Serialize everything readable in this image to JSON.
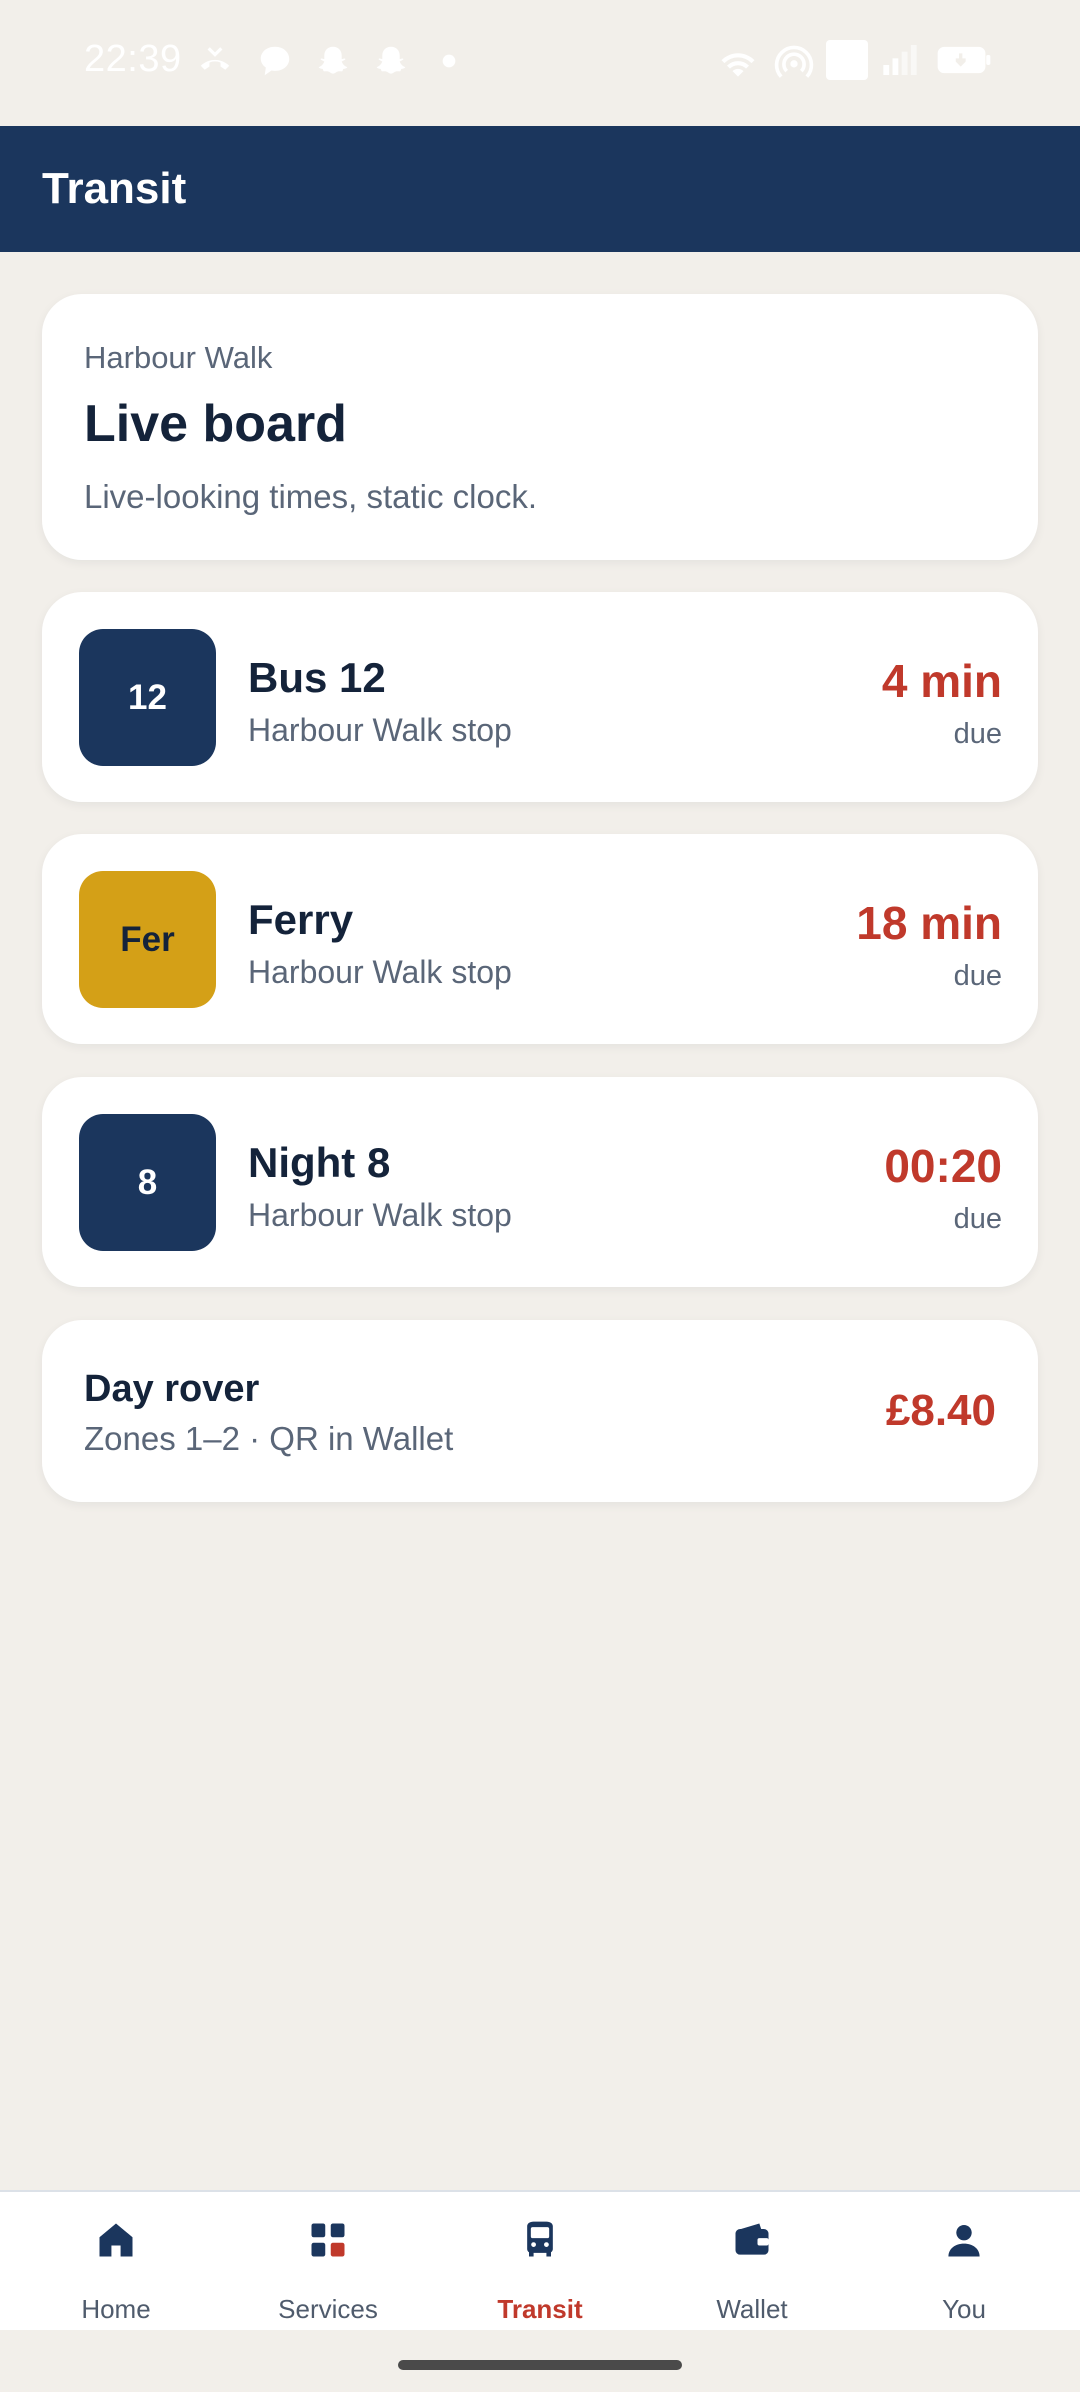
{
  "status_bar": {
    "time": "22:39",
    "left_icons": [
      "missed-call-icon",
      "chat-bubble-icon",
      "snapchat-ghost-icon",
      "snapchat-ghost-icon",
      "dot-icon"
    ],
    "right_icons": [
      "wifi-icon",
      "hotspot-icon",
      "vowifi-icon",
      "cellular-signal-icon",
      "battery-charging-icon"
    ]
  },
  "app_bar": {
    "title": "Transit"
  },
  "hero": {
    "kicker": "Harbour Walk",
    "title": "Live board",
    "subtitle": "Live-looking times, static clock."
  },
  "departures": [
    {
      "badge": "12",
      "badge_color": "#1B365D",
      "badge_text_color": "#FFFFFF",
      "title": "Bus 12",
      "stop": "Harbour Walk stop",
      "eta": "4 min",
      "eta_sub": "due"
    },
    {
      "badge": "Fer",
      "badge_color": "#D4A017",
      "badge_text_color": "#14233A",
      "title": "Ferry",
      "stop": "Harbour Walk stop",
      "eta": "18 min",
      "eta_sub": "due"
    },
    {
      "badge": "8",
      "badge_color": "#1B365D",
      "badge_text_color": "#FFFFFF",
      "title": "Night 8",
      "stop": "Harbour Walk stop",
      "eta": "00:20",
      "eta_sub": "due"
    }
  ],
  "ticket": {
    "title": "Day rover",
    "subtitle": "Zones 1–2 · QR in Wallet",
    "price": "£8.40"
  },
  "bottom_nav": {
    "active": "Transit",
    "items": [
      {
        "label": "Home",
        "icon": "home-icon"
      },
      {
        "label": "Services",
        "icon": "grid-icon"
      },
      {
        "label": "Transit",
        "icon": "bus-icon"
      },
      {
        "label": "Wallet",
        "icon": "wallet-icon"
      },
      {
        "label": "You",
        "icon": "person-icon"
      }
    ]
  },
  "colors": {
    "primary": "#1B365D",
    "accent": "#C0392B",
    "ferry": "#D4A017",
    "background": "#F2EFEA"
  }
}
